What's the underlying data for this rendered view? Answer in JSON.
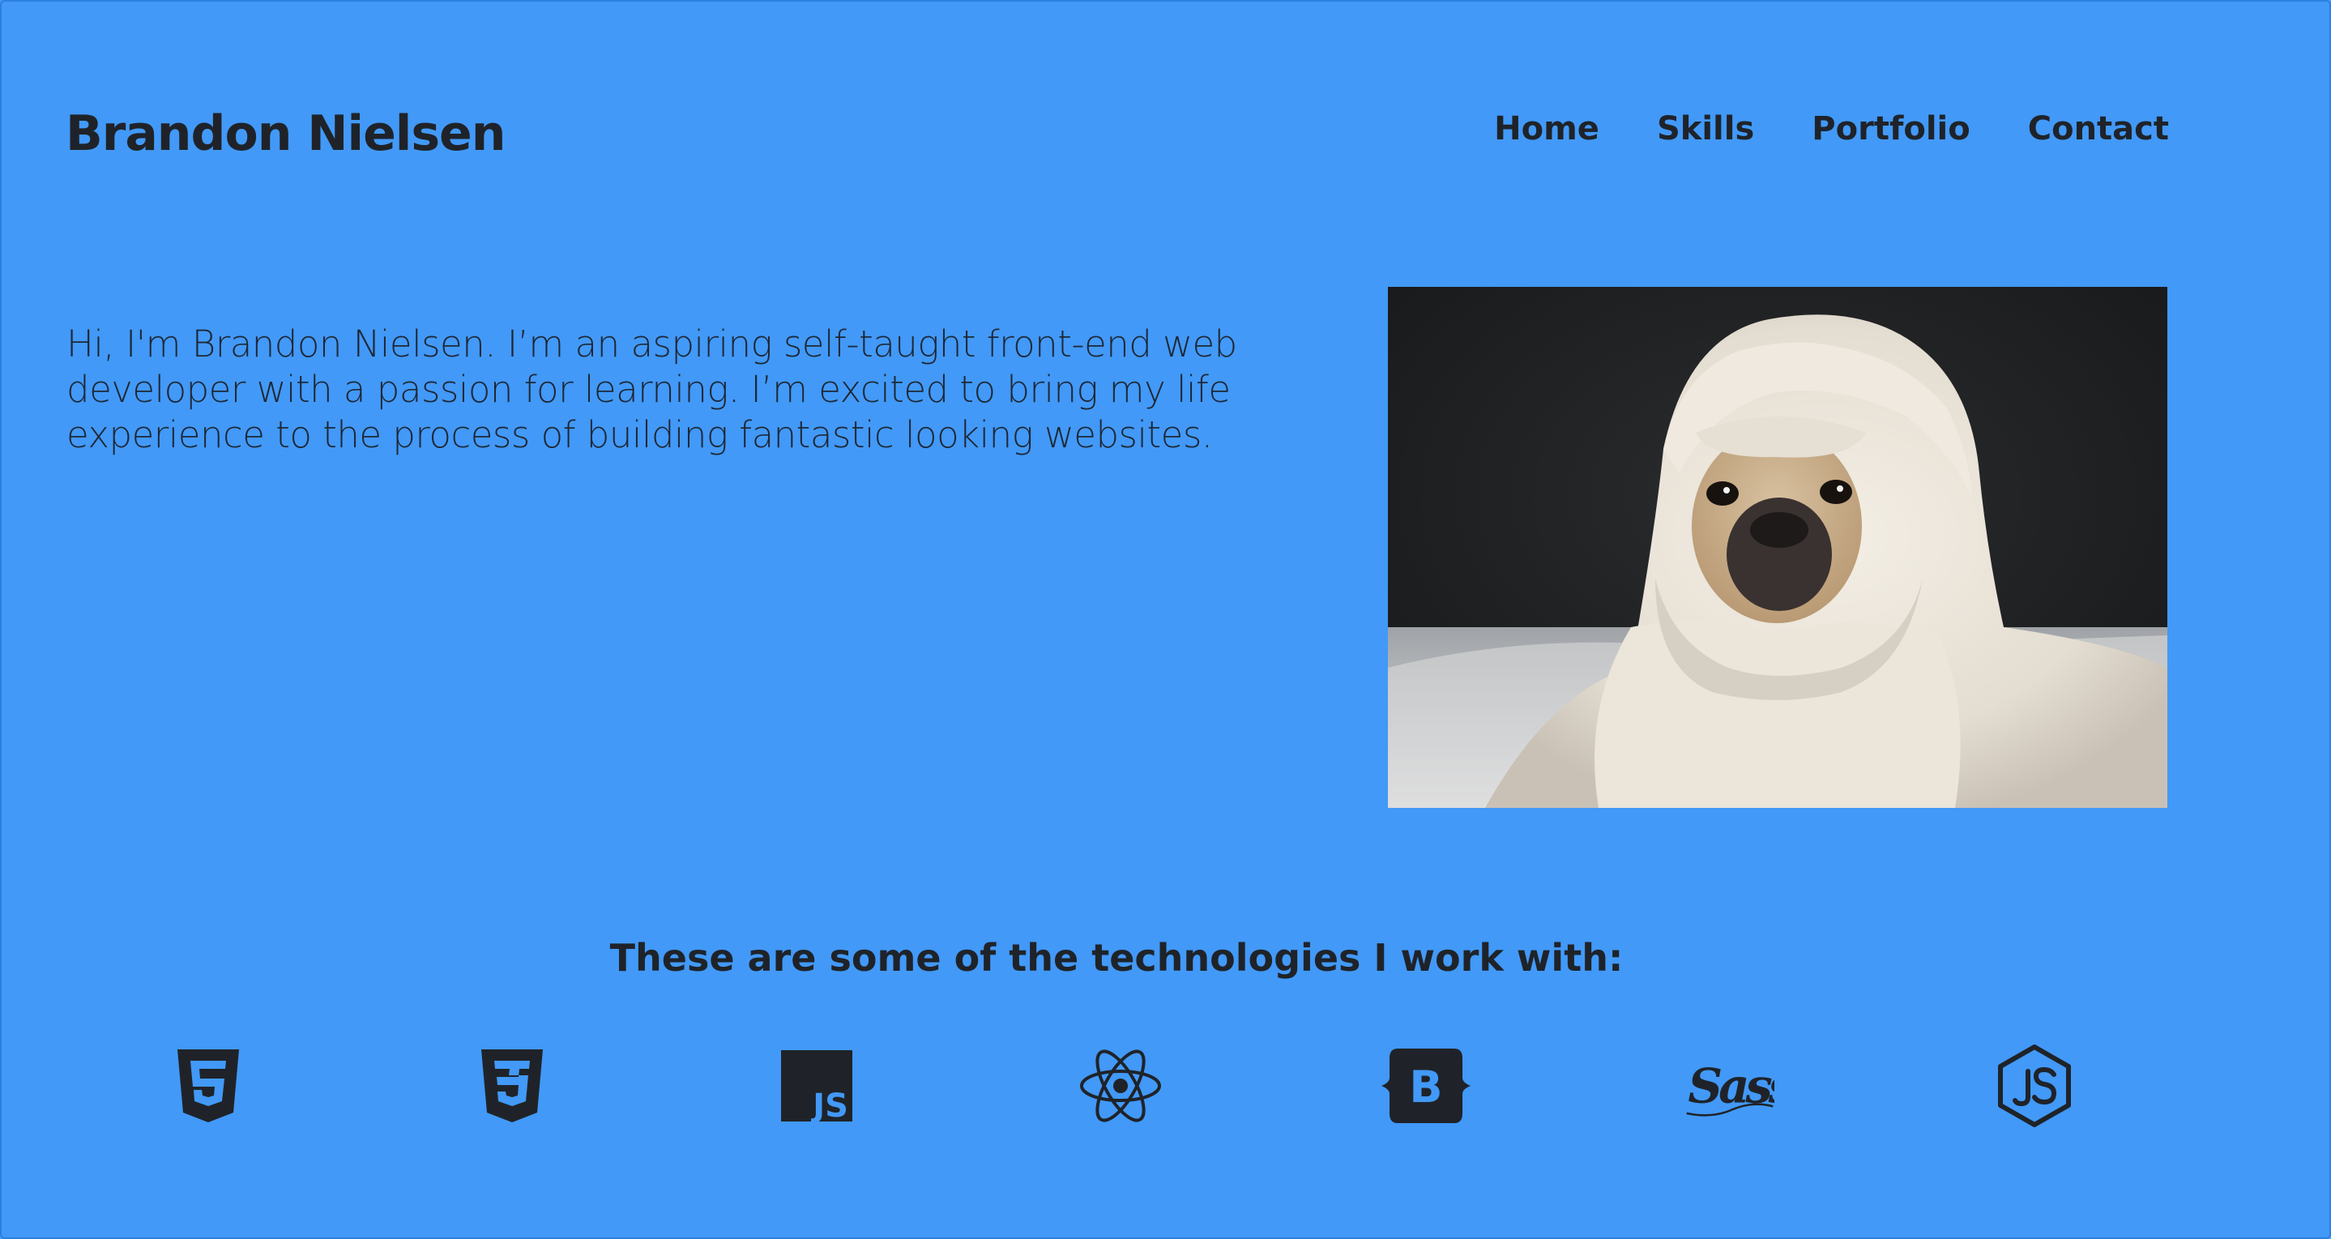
{
  "header": {
    "brand": "Brandon Nielsen",
    "nav": [
      "Home",
      "Skills",
      "Portfolio",
      "Contact"
    ]
  },
  "intro": {
    "text": "Hi, I'm Brandon Nielsen. I’m an aspiring self-taught front-end web developer with a passion for learning. I’m excited to bring my life experience to the process of building fantastic looking websites."
  },
  "technologies": {
    "heading": "These are some of the technologies I work with:",
    "icons": [
      "html5-icon",
      "css3-icon",
      "javascript-icon",
      "react-icon",
      "bootstrap-icon",
      "sass-icon",
      "nodejs-icon"
    ]
  },
  "colors": {
    "background": "#4299f7",
    "text": "#1f2329"
  }
}
